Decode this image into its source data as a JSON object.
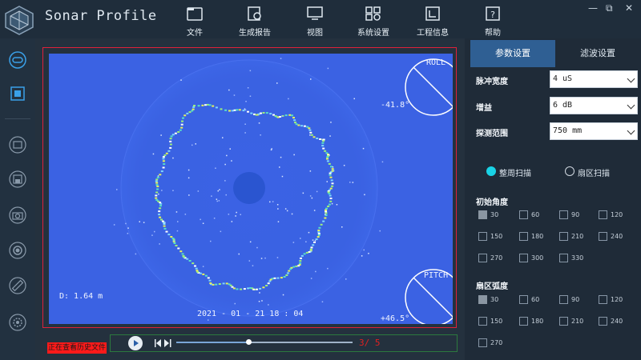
{
  "app": {
    "title": "Sonar Profile"
  },
  "menu": [
    {
      "id": "file",
      "label": "文件",
      "icon": "folder-icon"
    },
    {
      "id": "report",
      "label": "生成报告",
      "icon": "report-icon"
    },
    {
      "id": "view",
      "label": "视图",
      "icon": "monitor-icon"
    },
    {
      "id": "settings",
      "label": "系统设置",
      "icon": "grid-settings-icon"
    },
    {
      "id": "project",
      "label": "工程信息",
      "icon": "project-icon"
    },
    {
      "id": "help",
      "label": "帮助",
      "icon": "help-icon"
    }
  ],
  "window": {
    "minimize": "—",
    "restore": "⧉",
    "close": "✕"
  },
  "sidebar": [
    {
      "name": "connect-icon"
    },
    {
      "name": "chip-icon"
    },
    {
      "name": "open-folder-icon"
    },
    {
      "name": "save-icon"
    },
    {
      "name": "camera-icon"
    },
    {
      "name": "record-icon"
    },
    {
      "name": "ruler-icon"
    },
    {
      "name": "gear-icon"
    }
  ],
  "sonar": {
    "roll_label": "ROLL",
    "roll_value": "-41.8°",
    "pitch_label": "PITCH",
    "pitch_value": "+46.5°",
    "distance": "D: 1.64 m",
    "timestamp": "2021 - 01 - 21   18 : 04"
  },
  "playback": {
    "status": "正在查看历史文件",
    "counter": "3/ 5",
    "progress": 0.41
  },
  "tabs": {
    "params": "参数设置",
    "filter": "滤波设置"
  },
  "params": {
    "pulse_label": "脉冲宽度",
    "pulse_value": "4 uS",
    "gain_label": "增益",
    "gain_value": "6 dB",
    "range_label": "探测范围",
    "range_value": "750 mm"
  },
  "scan": {
    "full": "整周扫描",
    "sector": "扇区扫描",
    "selected": "full"
  },
  "start_angle": {
    "title": "初始角度",
    "options": [
      "30",
      "60",
      "90",
      "120",
      "150",
      "180",
      "210",
      "240",
      "270",
      "300",
      "330"
    ],
    "checked": "30"
  },
  "sector_angle": {
    "title": "扇区弧度",
    "options": [
      "30",
      "60",
      "90",
      "120",
      "150",
      "180",
      "210",
      "240",
      "270"
    ],
    "checked": "30"
  },
  "colors": {
    "accent": "#2f5f93",
    "sonar_bg": "#3b62e3",
    "red": "#ff1a1a",
    "teal": "#19d3e6"
  }
}
